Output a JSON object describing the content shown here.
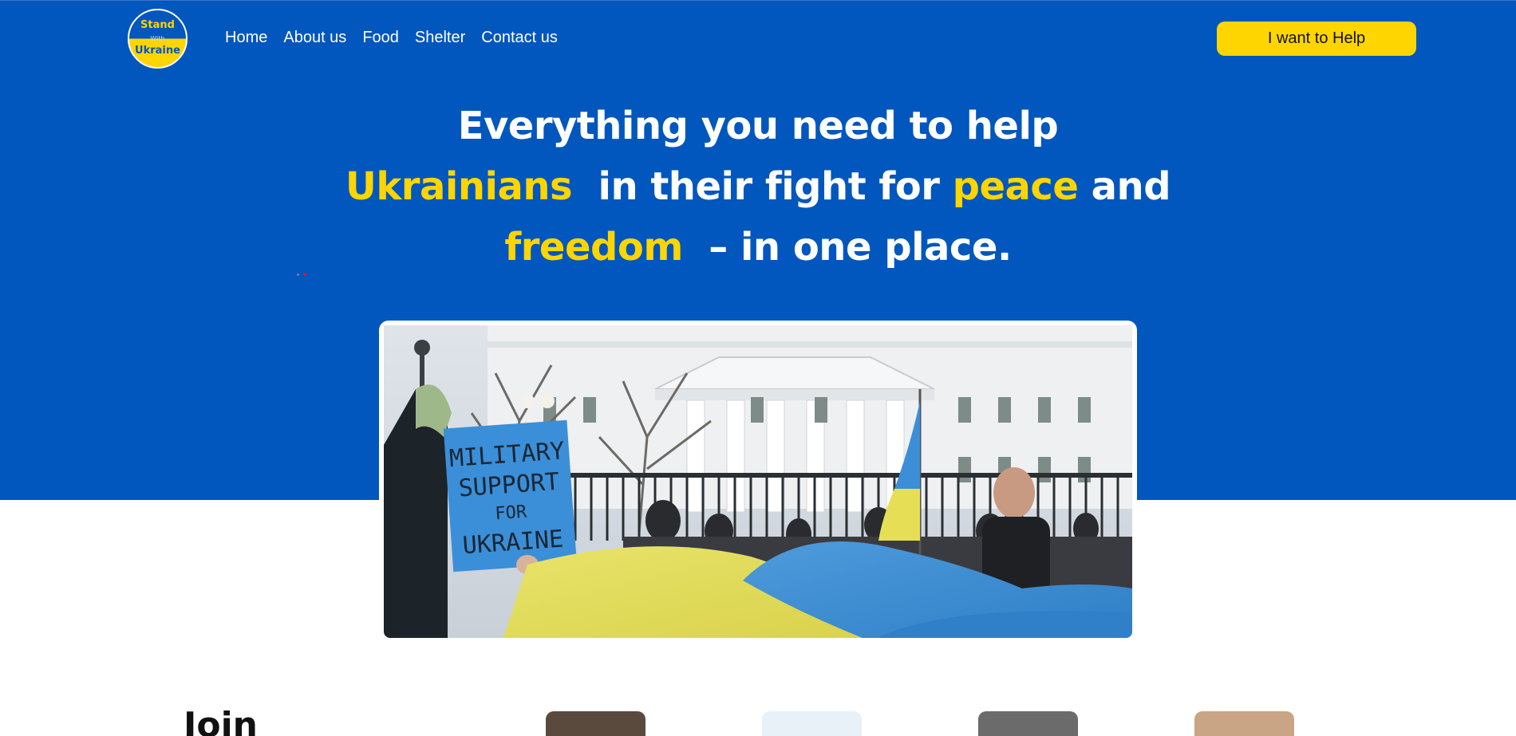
{
  "logo": {
    "line1": "Stand",
    "line2": "With",
    "line3": "Ukraine"
  },
  "nav": {
    "items": [
      "Home",
      "About us",
      "Food",
      "Shelter",
      "Contact us"
    ]
  },
  "cta": {
    "label": "I want to Help"
  },
  "headline": {
    "part1": "Everything you need to help",
    "hl1": "Ukrainians",
    "part2": "in their fight for",
    "hl2": "peace",
    "part3": "and",
    "hl3": "freedom",
    "part4": "– in one place."
  },
  "photo": {
    "sign_lines": [
      "MILITARY",
      "SUPPORT",
      "FOR",
      "UKRAINE"
    ]
  },
  "section": {
    "title": "Join"
  },
  "colors": {
    "primary_blue": "#0157bd",
    "accent_yellow": "#ffd500",
    "white": "#ffffff"
  }
}
